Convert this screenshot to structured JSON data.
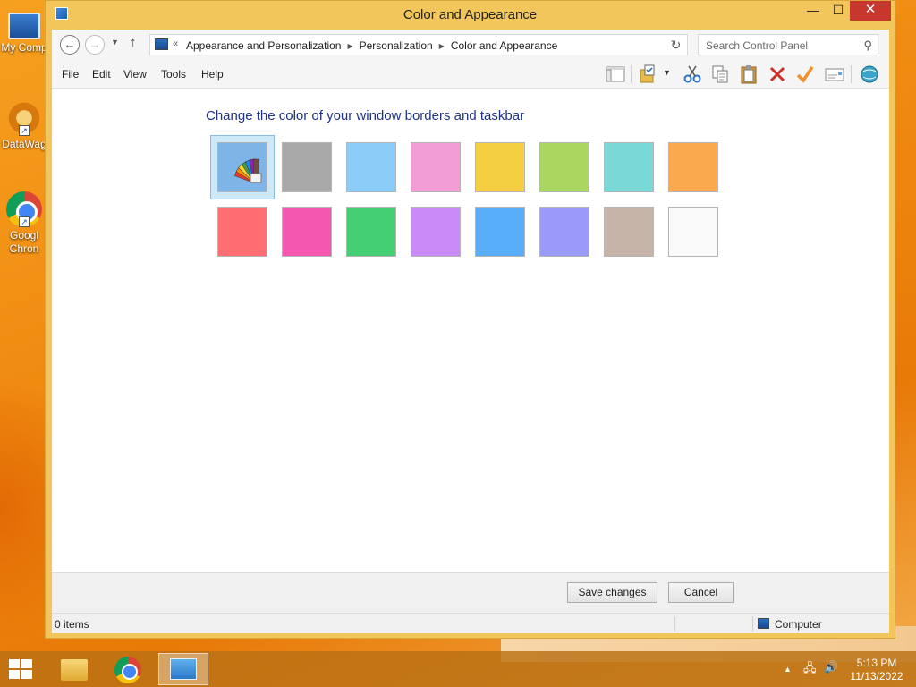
{
  "desktop": {
    "icons": [
      {
        "label": "My Comp",
        "icon": "computer-icon"
      },
      {
        "label": "DataWag",
        "icon": "datawag-icon"
      },
      {
        "label": "Googl\nChron",
        "line1": "Googl",
        "line2": "Chron",
        "icon": "chrome-icon"
      }
    ]
  },
  "window": {
    "title": "Color and Appearance",
    "controls": {
      "minimize": "—",
      "maximize": "☐",
      "close": "✕"
    }
  },
  "address": {
    "more": "«",
    "crumbs": [
      "Appearance and Personalization",
      "Personalization",
      "Color and Appearance"
    ],
    "search_placeholder": "Search Control Panel"
  },
  "menu": [
    "File",
    "Edit",
    "View",
    "Tools",
    "Help"
  ],
  "toolbar_icons": [
    "layout-icon",
    "properties-icon",
    "cut-icon",
    "copy-icon",
    "paste-icon",
    "delete-icon",
    "check-icon",
    "mail-icon",
    "globe-icon"
  ],
  "content": {
    "heading": "Change the color of your window borders and taskbar",
    "colors": [
      {
        "name": "automatic",
        "color": "#7fb4e6",
        "selected": true
      },
      {
        "name": "gray",
        "color": "#a8a8a8"
      },
      {
        "name": "light-blue",
        "color": "#8cccf8"
      },
      {
        "name": "pink",
        "color": "#f39dd7"
      },
      {
        "name": "yellow",
        "color": "#f3cf41"
      },
      {
        "name": "lime",
        "color": "#aad760"
      },
      {
        "name": "teal",
        "color": "#7ad8d7"
      },
      {
        "name": "orange",
        "color": "#fba94f"
      },
      {
        "name": "red",
        "color": "#fe6e72"
      },
      {
        "name": "magenta",
        "color": "#f357b0"
      },
      {
        "name": "green",
        "color": "#44cf75"
      },
      {
        "name": "purple",
        "color": "#c98bf7"
      },
      {
        "name": "blue",
        "color": "#58aef9"
      },
      {
        "name": "periwinkle",
        "color": "#9a9af8"
      },
      {
        "name": "taupe",
        "color": "#c6b4a8"
      },
      {
        "name": "white",
        "color": "#fafafa"
      }
    ]
  },
  "buttons": {
    "save": "Save changes",
    "cancel": "Cancel"
  },
  "status": {
    "items": "0 items",
    "location": "Computer"
  },
  "taskbar": {
    "apps": [
      "file-explorer-icon",
      "chrome-icon",
      "control-panel-icon"
    ],
    "time": "5:13 PM",
    "date": "11/13/2022"
  }
}
